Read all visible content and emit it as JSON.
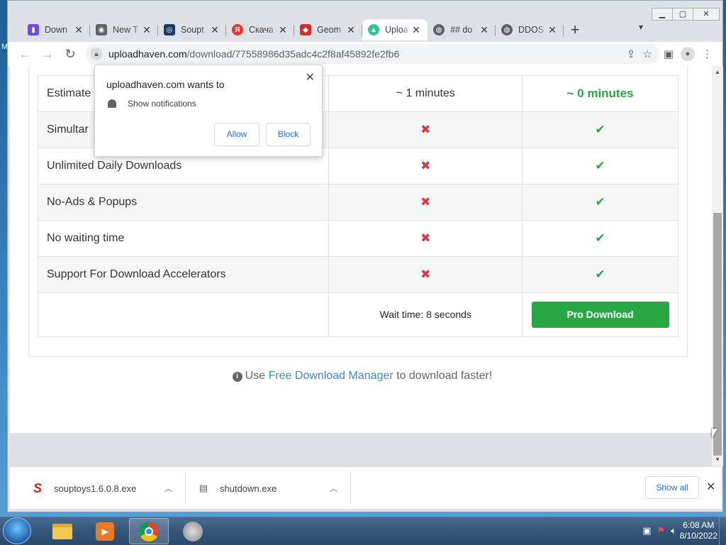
{
  "browser": {
    "tabs": [
      {
        "title": "Down",
        "favicon": "purple-app-icon",
        "color": "#6f4be0"
      },
      {
        "title": "New T",
        "favicon": "chrome-icon",
        "color": "#5f6368"
      },
      {
        "title": "Soupt",
        "favicon": "soup-icon",
        "color": "#1b3a68"
      },
      {
        "title": "Скача",
        "favicon": "yandex-icon",
        "color": "#e53935"
      },
      {
        "title": "Geom",
        "favicon": "geometry-icon",
        "color": "#d32f2f"
      },
      {
        "title": "Uploa",
        "favicon": "uploadhaven-icon",
        "color": "#34c38f",
        "active": true
      },
      {
        "title": "## do",
        "favicon": "globe-icon",
        "color": "#5f6368"
      },
      {
        "title": "DDOS",
        "favicon": "globe-icon",
        "color": "#5f6368"
      }
    ],
    "new_tab": "+",
    "url_host": "uploadhaven.com",
    "url_path": "/download/77558986d35adc4c2f8af45892fe2fb6"
  },
  "notification": {
    "title": "uploadhaven.com wants to",
    "permission": "Show notifications",
    "allow": "Allow",
    "block": "Block"
  },
  "page": {
    "rows": [
      {
        "name": "Estimate",
        "free": "~ 1 minutes",
        "pro": "~ 0 minutes",
        "type": "text"
      },
      {
        "name": "Simultar",
        "free": "✖",
        "pro": "✔",
        "type": "mark"
      },
      {
        "name": "Unlimited Daily Downloads",
        "free": "✖",
        "pro": "✔",
        "type": "mark"
      },
      {
        "name": "No-Ads & Popups",
        "free": "✖",
        "pro": "✔",
        "type": "mark"
      },
      {
        "name": "No waiting time",
        "free": "✖",
        "pro": "✔",
        "type": "mark"
      },
      {
        "name": "Support For Download Accelerators",
        "free": "✖",
        "pro": "✔",
        "type": "mark"
      }
    ],
    "wait_time": "Wait time: 8 seconds",
    "pro_button": "Pro Download",
    "fdm_prefix": "Use ",
    "fdm_link": "Free Download Manager",
    "fdm_suffix": " to download faster!"
  },
  "downloads": {
    "items": [
      {
        "name": "souptoys1.6.0.8.exe",
        "icon": "souptoys-icon"
      },
      {
        "name": "shutdown.exe",
        "icon": "exe-window-icon"
      }
    ],
    "show_all": "Show all"
  },
  "taskbar": {
    "time": "6:08 AM",
    "date": "8/10/2022"
  },
  "colors": {
    "accent_green": "#28a745",
    "cross_red": "#dc3545",
    "link_blue": "#3a8bc7",
    "footer_dark": "#2b2e36"
  }
}
